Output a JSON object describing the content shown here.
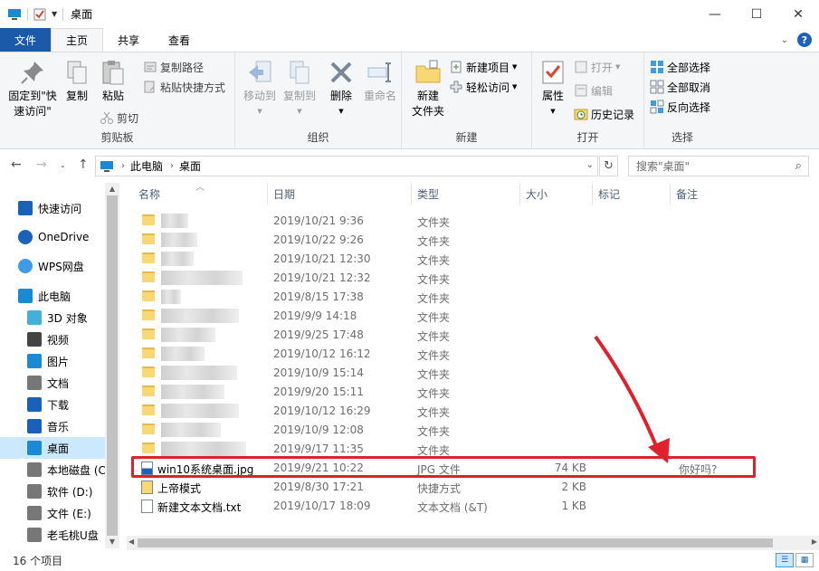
{
  "window": {
    "title": "桌面"
  },
  "tabs": {
    "file": "文件",
    "home": "主页",
    "share": "共享",
    "view": "查看"
  },
  "ribbon": {
    "clipboard": {
      "label": "剪贴板",
      "pin": "固定到\"快\n速访问\"",
      "pin_l1": "固定到\"快",
      "pin_l2": "速访问\"",
      "copy": "复制",
      "paste": "粘贴",
      "copy_path": "复制路径",
      "paste_shortcut": "粘贴快捷方式",
      "cut": "剪切"
    },
    "organize": {
      "label": "组织",
      "move_to": "移动到",
      "copy_to": "复制到",
      "delete": "删除",
      "rename": "重命名"
    },
    "new": {
      "label": "新建",
      "new_folder_l1": "新建",
      "new_folder_l2": "文件夹",
      "new_item": "新建项目",
      "easy_access": "轻松访问"
    },
    "open": {
      "label": "打开",
      "properties": "属性",
      "open": "打开",
      "edit": "编辑",
      "history": "历史记录"
    },
    "select": {
      "label": "选择",
      "select_all": "全部选择",
      "select_none": "全部取消",
      "invert": "反向选择"
    }
  },
  "address": {
    "root": "此电脑",
    "current": "桌面",
    "search_placeholder": "搜索\"桌面\""
  },
  "navpane": {
    "items": [
      {
        "label": "快速访问",
        "icon": "star-icon"
      },
      {
        "label": "OneDrive",
        "icon": "cloud-icon"
      },
      {
        "label": "WPS网盘",
        "icon": "wps-cloud-icon"
      },
      {
        "label": "此电脑",
        "icon": "computer-icon"
      },
      {
        "label": "3D 对象",
        "icon": "cube-icon"
      },
      {
        "label": "视频",
        "icon": "video-icon"
      },
      {
        "label": "图片",
        "icon": "picture-icon"
      },
      {
        "label": "文档",
        "icon": "document-icon"
      },
      {
        "label": "下载",
        "icon": "download-icon"
      },
      {
        "label": "音乐",
        "icon": "music-icon"
      },
      {
        "label": "桌面",
        "icon": "desktop-icon"
      },
      {
        "label": "本地磁盘 (C",
        "icon": "drive-icon"
      },
      {
        "label": "软件 (D:)",
        "icon": "drive-icon"
      },
      {
        "label": "文件 (E:)",
        "icon": "drive-icon"
      },
      {
        "label": "老毛桃U盘",
        "icon": "usb-drive-icon"
      }
    ]
  },
  "columns": {
    "name": "名称",
    "date": "日期",
    "type": "类型",
    "size": "大小",
    "tags": "标记",
    "notes": "备注"
  },
  "files": [
    {
      "date": "2019/10/21 9:36",
      "type": "文件夹"
    },
    {
      "date": "2019/10/22 9:26",
      "type": "文件夹"
    },
    {
      "date": "2019/10/21 12:30",
      "type": "文件夹"
    },
    {
      "date": "2019/10/21 12:32",
      "type": "文件夹"
    },
    {
      "date": "2019/8/15 17:38",
      "type": "文件夹"
    },
    {
      "date": "2019/9/9 14:18",
      "type": "文件夹"
    },
    {
      "date": "2019/9/25 17:48",
      "type": "文件夹"
    },
    {
      "date": "2019/10/12 16:12",
      "type": "文件夹"
    },
    {
      "date": "2019/10/9 15:14",
      "type": "文件夹"
    },
    {
      "date": "2019/9/20 15:11",
      "type": "文件夹"
    },
    {
      "date": "2019/10/12 16:29",
      "type": "文件夹"
    },
    {
      "date": "2019/10/9 12:08",
      "type": "文件夹"
    },
    {
      "date": "2019/9/17 11:35",
      "type": "文件夹"
    },
    {
      "name": "win10系统桌面.jpg",
      "date": "2019/9/21 10:22",
      "type": "JPG 文件",
      "size": "74 KB",
      "note": "你好吗?"
    },
    {
      "name": "上帝模式",
      "date": "2019/8/30 17:21",
      "type": "快捷方式",
      "size": "2 KB"
    },
    {
      "name": "新建文本文档.txt",
      "date": "2019/10/17 18:09",
      "type": "文本文档 (&T)",
      "size": "1 KB"
    }
  ],
  "status": {
    "count": "16 个项目"
  },
  "colors": {
    "accent": "#1a62b8",
    "highlight": "#e0202a",
    "selection": "#cce8ff"
  }
}
